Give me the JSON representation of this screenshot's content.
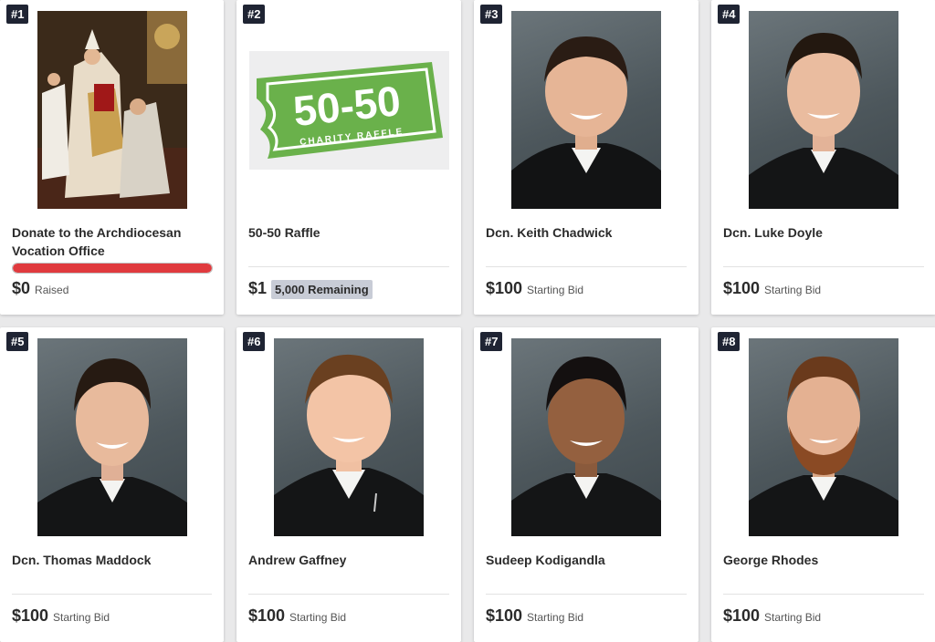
{
  "items": [
    {
      "num": "#1",
      "title": "Donate to the Archdiocesan Vocation Office",
      "amount": "$0",
      "sub": "Raised",
      "progress_fraction": 1.0
    },
    {
      "num": "#2",
      "title": "50-50 Raffle",
      "amount": "$1",
      "sub": "5,000 Remaining",
      "logo_text": "50-50",
      "logo_sub": "CHARITY RAFFLE"
    },
    {
      "num": "#3",
      "title": "Dcn. Keith Chadwick",
      "amount": "$100",
      "sub": "Starting Bid"
    },
    {
      "num": "#4",
      "title": "Dcn. Luke Doyle",
      "amount": "$100",
      "sub": "Starting Bid"
    },
    {
      "num": "#5",
      "title": "Dcn. Thomas Maddock",
      "amount": "$100",
      "sub": "Starting Bid"
    },
    {
      "num": "#6",
      "title": "Andrew Gaffney",
      "amount": "$100",
      "sub": "Starting Bid"
    },
    {
      "num": "#7",
      "title": "Sudeep Kodigandla",
      "amount": "$100",
      "sub": "Starting Bid"
    },
    {
      "num": "#8",
      "title": "George Rhodes",
      "amount": "$100",
      "sub": "Starting Bid"
    }
  ],
  "colors": {
    "badge": "#1f2433",
    "progress": "#e03a3e",
    "raffle_green": "#6ab14b"
  }
}
